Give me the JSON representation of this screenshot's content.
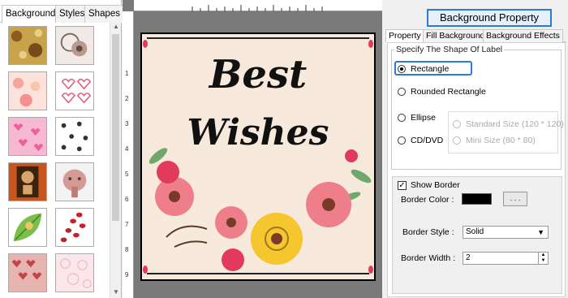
{
  "left_panel": {
    "tabs": [
      "Backgrounds",
      "Styles",
      "Shapes"
    ],
    "active_tab": "Backgrounds"
  },
  "canvas": {
    "card_line1": "Best",
    "card_line2": "Wishes",
    "ruler_left_marks": [
      "1",
      "2",
      "3",
      "4",
      "5",
      "6",
      "7",
      "8",
      "9"
    ]
  },
  "right_panel": {
    "header_button": "Background Property",
    "tabs": [
      "Property",
      "Fill Background",
      "Background Effects"
    ],
    "active_tab": "Property",
    "shape_group_title": "Specify The Shape Of Label",
    "shapes": {
      "rectangle": "Rectangle",
      "rounded_rectangle": "Rounded Rectangle",
      "ellipse": "Ellipse",
      "cd_dvd": "CD/DVD"
    },
    "selected_shape": "Rectangle",
    "cd_sizes": {
      "standard": "Standard Size (120 * 120)",
      "mini": "Mini Size (80 * 80)"
    },
    "show_border_label": "Show Border",
    "show_border_checked": true,
    "border_color_label": "Border Color :",
    "border_color_value": "#000000",
    "color_picker_button": ". . .",
    "border_style_label": "Border Style :",
    "border_style_value": "Solid",
    "border_width_label": "Border Width :",
    "border_width_value": "2"
  },
  "colors": {
    "accent": "#2c7ad6",
    "card_background": "#f7e9dc",
    "workspace": "#7a7a7a"
  }
}
